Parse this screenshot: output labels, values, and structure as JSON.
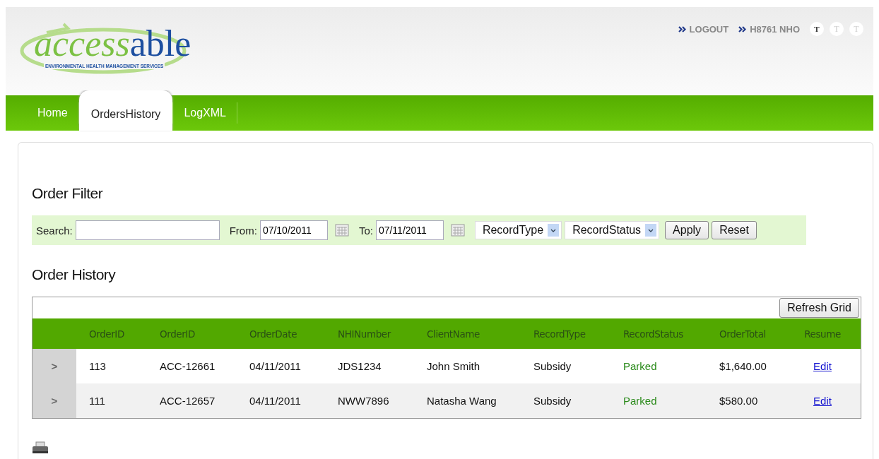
{
  "logo": {
    "part_1": "access",
    "part_2": "able",
    "tagline": "ENVIRONMENTAL HEALTH MANAGEMENT SERVICES"
  },
  "user_links": [
    "LOGOUT",
    "H8761 NHO"
  ],
  "text_size_buttons": [
    {
      "label": "T",
      "selected": true
    },
    {
      "label": "T",
      "selected": false
    },
    {
      "label": "T",
      "selected": false
    }
  ],
  "tabs": [
    {
      "label": "Home",
      "selected": false
    },
    {
      "label": "OrdersHistory",
      "selected": true
    },
    {
      "label": "LogXML",
      "selected": false
    }
  ],
  "filter": {
    "title": "Order Filter",
    "search_label": "Search:",
    "from_label": "From:",
    "from_value": "07/10/2011",
    "to_label": "To:",
    "to_value": "07/11/2011",
    "record_type": "RecordType",
    "record_status": "RecordStatus",
    "apply": "Apply",
    "reset": "Reset"
  },
  "history": {
    "title": "Order History",
    "refresh": "Refresh Grid",
    "columns": [
      {
        "label": "OrderID",
        "kind": "text"
      },
      {
        "label": "OrderID",
        "kind": "text"
      },
      {
        "label": "OrderDate",
        "kind": "text"
      },
      {
        "label": "NHINumber",
        "kind": "text"
      },
      {
        "label": "ClientName",
        "kind": "text"
      },
      {
        "label": "RecordType",
        "kind": "text"
      },
      {
        "label": "RecordStatus",
        "kind": "status"
      },
      {
        "label": "OrderTotal",
        "kind": "text"
      },
      {
        "label": "Resume",
        "kind": "link"
      }
    ],
    "rows": [
      {
        "expander": ">",
        "cells": [
          "113",
          "ACC-12661",
          "04/11/2011",
          "JDS1234",
          "John Smith",
          "Subsidy",
          "Parked",
          "$1,640.00",
          "Edit"
        ]
      },
      {
        "expander": ">",
        "cells": [
          "111",
          "ACC-12657",
          "04/11/2011",
          "NWW7896",
          "Natasha Wang",
          "Subsidy",
          "Parked",
          "$580.00",
          "Edit"
        ]
      }
    ]
  }
}
